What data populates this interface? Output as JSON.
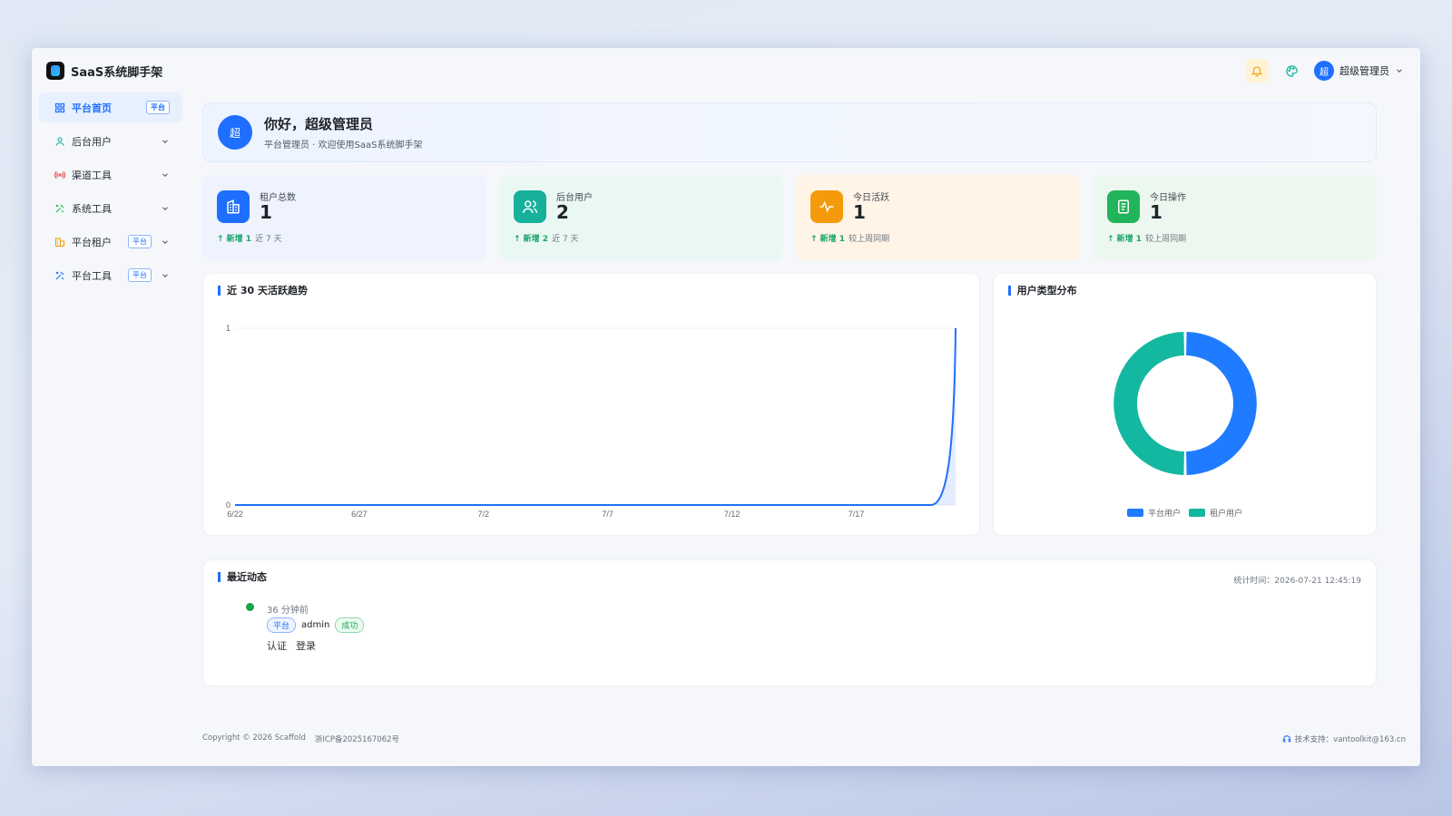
{
  "app": {
    "title": "SaaS系统脚手架"
  },
  "header": {
    "user_name": "超级管理员",
    "avatar_text": "超"
  },
  "sidebar": {
    "items": [
      {
        "label": "平台首页",
        "badge": "平台"
      },
      {
        "label": "后台用户"
      },
      {
        "label": "渠道工具"
      },
      {
        "label": "系统工具"
      },
      {
        "label": "平台租户",
        "badge": "平台"
      },
      {
        "label": "平台工具",
        "badge": "平台"
      }
    ]
  },
  "welcome": {
    "avatar_text": "超",
    "title": "你好，超级管理员",
    "subtitle": "平台管理员 · 欢迎使用SaaS系统脚手架"
  },
  "stats": [
    {
      "label": "租户总数",
      "value": "1",
      "delta": "↑ 新增 1",
      "period": "近 7 天",
      "color": "#1f6fff",
      "bg": "#eef3fd"
    },
    {
      "label": "后台用户",
      "value": "2",
      "delta": "↑ 新增 2",
      "period": "近 7 天",
      "color": "#16b09b",
      "bg": "#eaf8f4"
    },
    {
      "label": "今日活跃",
      "value": "1",
      "delta": "↑ 新增 1",
      "period": "较上周同期",
      "color": "#f59a0b",
      "bg": "#fff4e6"
    },
    {
      "label": "今日操作",
      "value": "1",
      "delta": "↑ 新增 1",
      "period": "较上周同期",
      "color": "#22b45a",
      "bg": "#ecf8ef"
    }
  ],
  "line_chart_title": "近 30 天活跃趋势",
  "pie_chart_title": "用户类型分布",
  "chart_data": [
    {
      "type": "line",
      "title": "近 30 天活跃趋势",
      "x": [
        "6/22",
        "6/23",
        "6/24",
        "6/25",
        "6/26",
        "6/27",
        "6/28",
        "6/29",
        "6/30",
        "7/1",
        "7/2",
        "7/3",
        "7/4",
        "7/5",
        "7/6",
        "7/7",
        "7/8",
        "7/9",
        "7/10",
        "7/11",
        "7/12",
        "7/13",
        "7/14",
        "7/15",
        "7/16",
        "7/17",
        "7/18",
        "7/19",
        "7/20",
        "7/21"
      ],
      "x_tick_labels": [
        "6/22",
        "6/27",
        "7/2",
        "7/7",
        "7/12",
        "7/17"
      ],
      "series": [
        {
          "values": [
            0,
            0,
            0,
            0,
            0,
            0,
            0,
            0,
            0,
            0,
            0,
            0,
            0,
            0,
            0,
            0,
            0,
            0,
            0,
            0,
            0,
            0,
            0,
            0,
            0,
            0,
            0,
            0,
            0,
            1
          ]
        }
      ],
      "y_ticks": [
        "0",
        "1"
      ],
      "ylim": [
        0,
        1
      ],
      "color": "#1f6fff"
    },
    {
      "type": "pie",
      "title": "用户类型分布",
      "labels": [
        "平台用户",
        "租户用户"
      ],
      "values": [
        1,
        1
      ],
      "colors": [
        "#1f7bff",
        "#14b8a0"
      ],
      "legend": "bottom"
    }
  ],
  "activity": {
    "title": "最近动态",
    "stat_time": "统计时间：2026-07-21 12:45:19",
    "items": [
      {
        "time": "36 分钟前",
        "tag": "平台",
        "user": "admin",
        "status": "成功",
        "module": "认证",
        "action": "登录"
      }
    ]
  },
  "footer": {
    "copyright": "Copyright © 2026 Scaffold",
    "icp": "浙ICP备2025167062号",
    "support": "技术支持：vantoolkit@163.cn"
  }
}
